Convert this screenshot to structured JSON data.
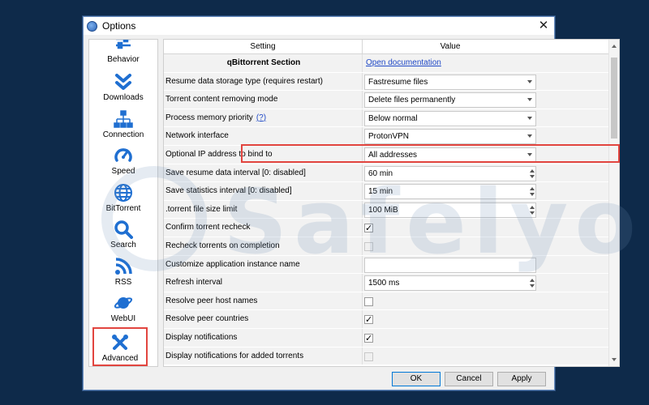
{
  "window": {
    "title": "Options"
  },
  "sidebar": {
    "items": [
      {
        "label": "Behavior",
        "icon": "sliders-icon"
      },
      {
        "label": "Downloads",
        "icon": "double-chevron-down-icon"
      },
      {
        "label": "Connection",
        "icon": "network-icon"
      },
      {
        "label": "Speed",
        "icon": "speedometer-icon"
      },
      {
        "label": "BitTorrent",
        "icon": "globe-icon"
      },
      {
        "label": "Search",
        "icon": "search-icon"
      },
      {
        "label": "RSS",
        "icon": "rss-icon"
      },
      {
        "label": "WebUI",
        "icon": "planet-icon"
      },
      {
        "label": "Advanced",
        "icon": "tools-icon"
      }
    ]
  },
  "table": {
    "headers": {
      "setting": "Setting",
      "value": "Value"
    },
    "section": {
      "label": "qBittorrent Section",
      "link": "Open documentation"
    },
    "rows": [
      {
        "setting": "Resume data storage type (requires restart)",
        "value": "Fastresume files"
      },
      {
        "setting": "Torrent content removing mode",
        "value": "Delete files permanently"
      },
      {
        "setting": "Process memory priority",
        "help": "(?)",
        "value": "Below normal"
      },
      {
        "setting": "Network interface",
        "value": "ProtonVPN"
      },
      {
        "setting": "Optional IP address to bind to",
        "value": "All addresses"
      },
      {
        "setting": "Save resume data interval [0: disabled]",
        "value": "60 min"
      },
      {
        "setting": "Save statistics interval [0: disabled]",
        "value": "15 min"
      },
      {
        "setting": ".torrent file size limit",
        "value": "100 MiB"
      },
      {
        "setting": "Confirm torrent recheck",
        "checked": "✓"
      },
      {
        "setting": "Recheck torrents on completion",
        "checked": ""
      },
      {
        "setting": "Customize application instance name",
        "value": ""
      },
      {
        "setting": "Refresh interval",
        "value": "1500 ms"
      },
      {
        "setting": "Resolve peer host names",
        "checked": ""
      },
      {
        "setting": "Resolve peer countries",
        "checked": "✓"
      },
      {
        "setting": "Display notifications",
        "checked": "✓"
      },
      {
        "setting": "Display notifications for added torrents",
        "checked": ""
      }
    ]
  },
  "buttons": {
    "ok": "OK",
    "cancel": "Cancel",
    "apply": "Apply"
  },
  "watermark": {
    "text": "Safelyo"
  },
  "colors": {
    "highlight": "#e2453f",
    "accent_icon": "#1f6fd1",
    "link": "#1f49c7"
  }
}
